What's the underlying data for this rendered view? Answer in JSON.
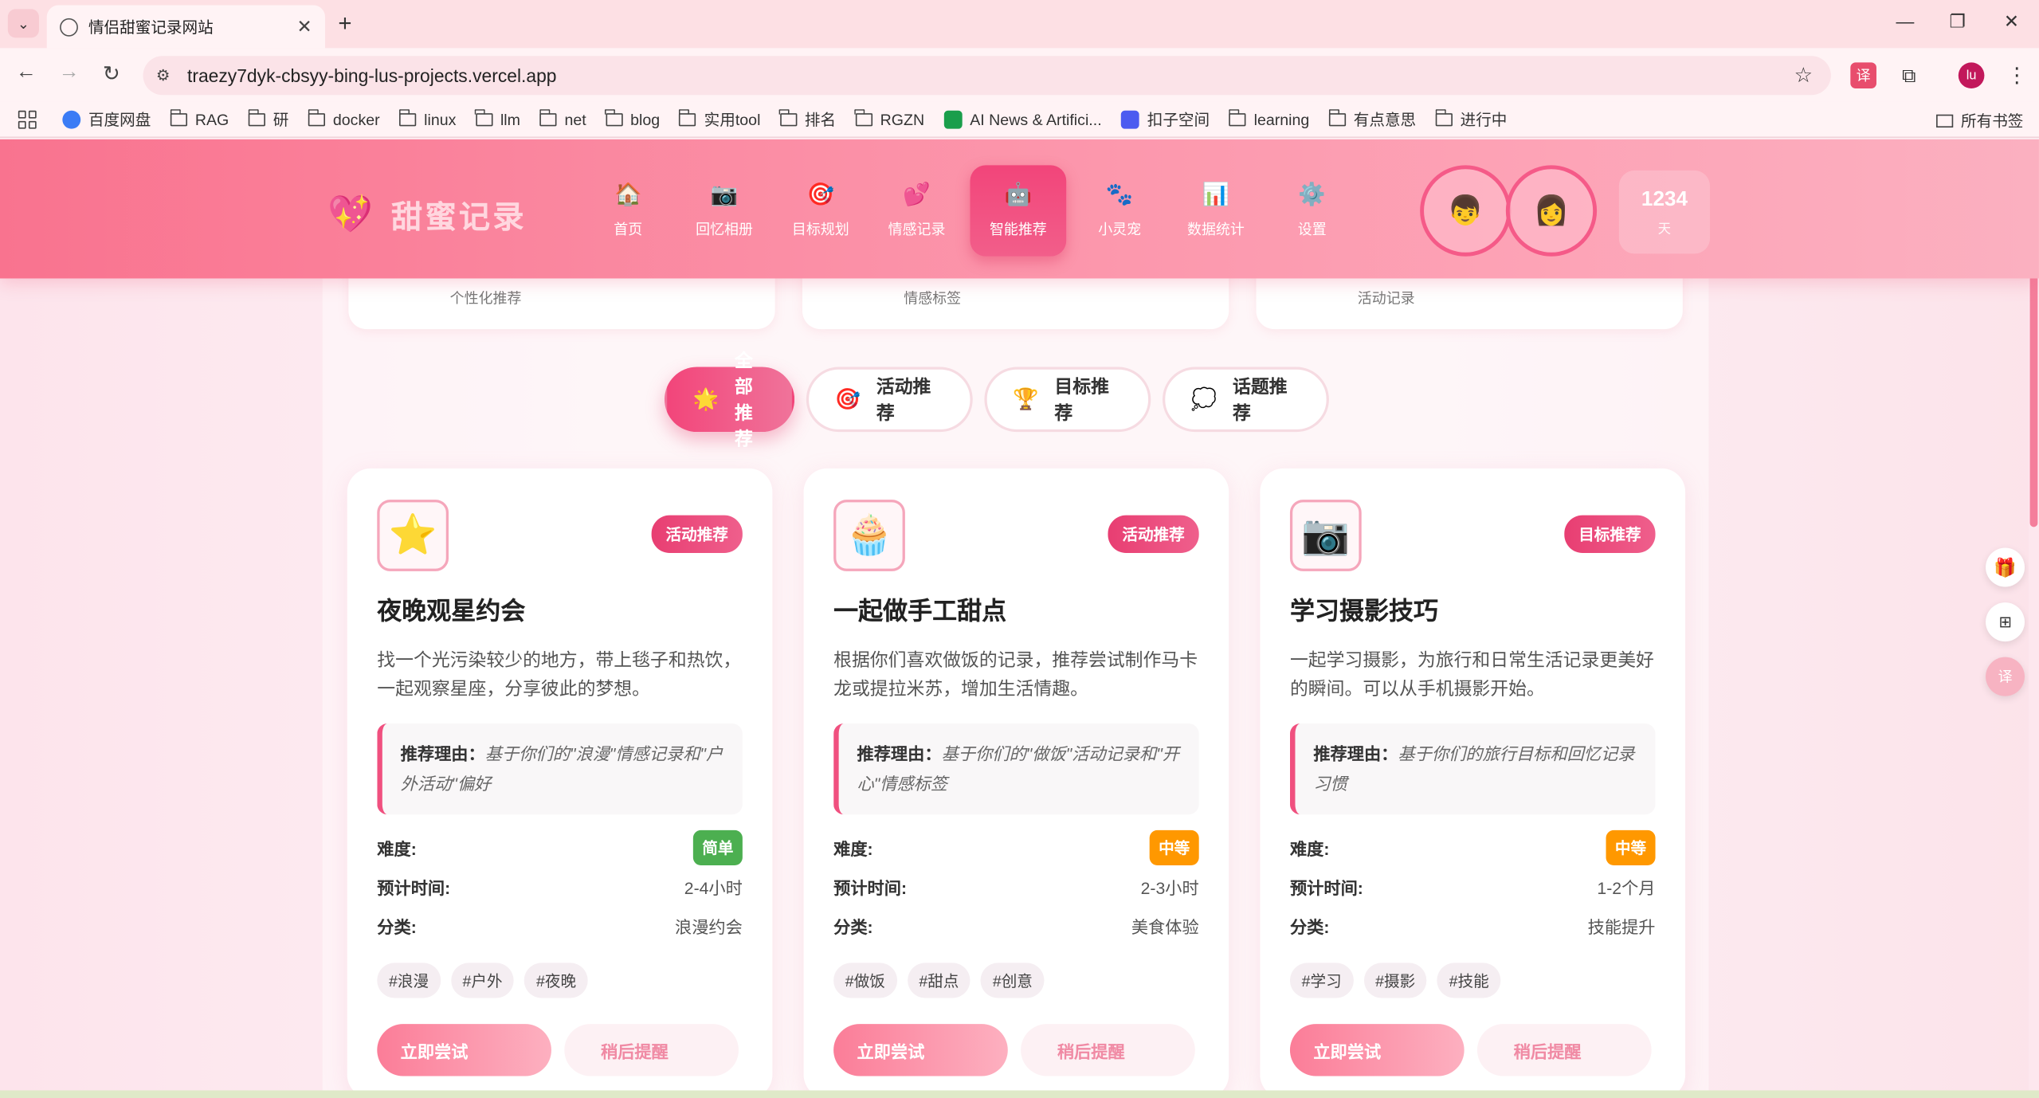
{
  "browser": {
    "tab_title": "情侣甜蜜记录网站",
    "url": "traezy7dyk-cbsyy-bing-lus-projects.vercel.app",
    "profile_initials": "lu",
    "bookmarks": [
      "百度网盘",
      "RAG",
      "研",
      "docker",
      "linux",
      "llm",
      "net",
      "blog",
      "实用tool",
      "排名",
      "RGZN",
      "AI News & Artifici...",
      "扣子空间",
      "learning",
      "有点意思",
      "进行中"
    ],
    "all_bookmarks": "所有书签"
  },
  "header": {
    "logo_text": "甜蜜记录",
    "nav": [
      {
        "label": "首页",
        "icon": "🏠"
      },
      {
        "label": "回忆相册",
        "icon": "📷"
      },
      {
        "label": "目标规划",
        "icon": "🎯"
      },
      {
        "label": "情感记录",
        "icon": "💕"
      },
      {
        "label": "智能推荐",
        "icon": "🤖"
      },
      {
        "label": "小灵宠",
        "icon": "🐾"
      },
      {
        "label": "数据统计",
        "icon": "📊"
      },
      {
        "label": "设置",
        "icon": "⚙️"
      }
    ],
    "days_count": "1234",
    "days_unit": "天"
  },
  "stats": [
    "个性化推荐",
    "情感标签",
    "活动记录"
  ],
  "filters": [
    {
      "label": "全部推荐",
      "icon": "🌟"
    },
    {
      "label": "活动推荐",
      "icon": "🎯"
    },
    {
      "label": "目标推荐",
      "icon": "🏆"
    },
    {
      "label": "话题推荐",
      "icon": "💭"
    }
  ],
  "labels": {
    "reason": "推荐理由：",
    "difficulty": "难度:",
    "time": "预计时间:",
    "category": "分类:",
    "try": "立即尝试",
    "later": "稍后提醒"
  },
  "cards": [
    {
      "icon": "⭐",
      "badge": "活动推荐",
      "title": "夜晚观星约会",
      "desc": "找一个光污染较少的地方，带上毯子和热饮，一起观察星座，分享彼此的梦想。",
      "reason": "基于你们的\"浪漫\"情感记录和\"户外活动\"偏好",
      "difficulty": "简单",
      "difficulty_color": "#4caf50",
      "time": "2-4小时",
      "category": "浪漫约会",
      "tags": [
        "#浪漫",
        "#户外",
        "#夜晚"
      ]
    },
    {
      "icon": "🧁",
      "badge": "活动推荐",
      "title": "一起做手工甜点",
      "desc": "根据你们喜欢做饭的记录，推荐尝试制作马卡龙或提拉米苏，增加生活情趣。",
      "reason": "基于你们的\"做饭\"活动记录和\"开心\"情感标签",
      "difficulty": "中等",
      "difficulty_color": "#ff9800",
      "time": "2-3小时",
      "category": "美食体验",
      "tags": [
        "#做饭",
        "#甜点",
        "#创意"
      ]
    },
    {
      "icon": "📷",
      "badge": "目标推荐",
      "title": "学习摄影技巧",
      "desc": "一起学习摄影，为旅行和日常生活记录更美好的瞬间。可以从手机摄影开始。",
      "reason": "基于你们的旅行目标和回忆记录习惯",
      "difficulty": "中等",
      "difficulty_color": "#ff9800",
      "time": "1-2个月",
      "category": "技能提升",
      "tags": [
        "#学习",
        "#摄影",
        "#技能"
      ]
    }
  ]
}
